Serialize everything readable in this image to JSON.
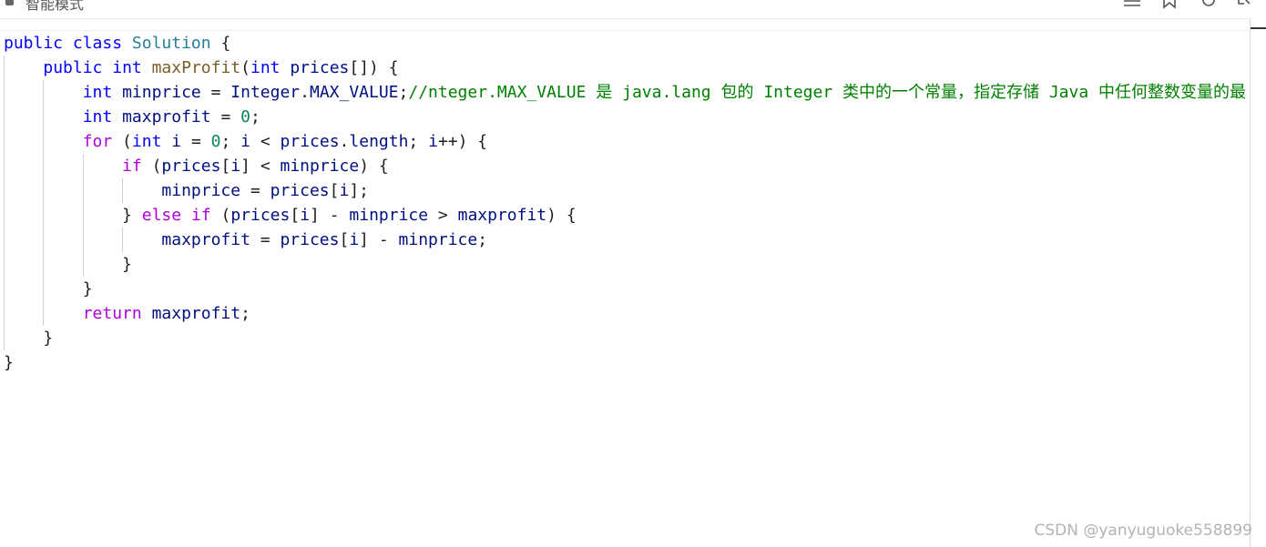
{
  "toolbar": {
    "mode_label": "智能模式",
    "icons": [
      "menu-icon",
      "bookmark-icon",
      "refresh-icon",
      "share-icon"
    ]
  },
  "colors": {
    "keyword": "#0000ff",
    "control": "#af00db",
    "class": "#267f99",
    "function": "#795e26",
    "variable": "#001080",
    "number": "#098658",
    "comment": "#008000",
    "plain": "#1f1f1f"
  },
  "code": {
    "language": "java",
    "lines": [
      {
        "indent": 0,
        "tokens": [
          [
            "kw",
            "public"
          ],
          [
            "p",
            " "
          ],
          [
            "kw",
            "class"
          ],
          [
            "p",
            " "
          ],
          [
            "cls",
            "Solution"
          ],
          [
            "p",
            " {"
          ]
        ]
      },
      {
        "indent": 1,
        "tokens": [
          [
            "kw",
            "public"
          ],
          [
            "p",
            " "
          ],
          [
            "type",
            "int"
          ],
          [
            "p",
            " "
          ],
          [
            "fn",
            "maxProfit"
          ],
          [
            "p",
            "("
          ],
          [
            "type",
            "int"
          ],
          [
            "p",
            " "
          ],
          [
            "var",
            "prices"
          ],
          [
            "p",
            "[]) {"
          ]
        ]
      },
      {
        "indent": 2,
        "tokens": [
          [
            "type",
            "int"
          ],
          [
            "p",
            " "
          ],
          [
            "var",
            "minprice"
          ],
          [
            "p",
            " = "
          ],
          [
            "var",
            "Integer"
          ],
          [
            "p",
            "."
          ],
          [
            "var",
            "MAX_VALUE"
          ],
          [
            "p",
            ";"
          ],
          [
            "com",
            "//nteger.MAX_VALUE 是 java.lang 包的 Integer 类中的一个常量，指定存储 Java 中任何整数变量的最"
          ]
        ]
      },
      {
        "indent": 2,
        "tokens": [
          [
            "type",
            "int"
          ],
          [
            "p",
            " "
          ],
          [
            "var",
            "maxprofit"
          ],
          [
            "p",
            " = "
          ],
          [
            "num",
            "0"
          ],
          [
            "p",
            ";"
          ]
        ]
      },
      {
        "indent": 2,
        "tokens": [
          [
            "ctl",
            "for"
          ],
          [
            "p",
            " ("
          ],
          [
            "type",
            "int"
          ],
          [
            "p",
            " "
          ],
          [
            "var",
            "i"
          ],
          [
            "p",
            " = "
          ],
          [
            "num",
            "0"
          ],
          [
            "p",
            "; "
          ],
          [
            "var",
            "i"
          ],
          [
            "p",
            " < "
          ],
          [
            "var",
            "prices"
          ],
          [
            "p",
            "."
          ],
          [
            "var",
            "length"
          ],
          [
            "p",
            "; "
          ],
          [
            "var",
            "i"
          ],
          [
            "p",
            "++) {"
          ]
        ]
      },
      {
        "indent": 3,
        "tokens": [
          [
            "ctl",
            "if"
          ],
          [
            "p",
            " ("
          ],
          [
            "var",
            "prices"
          ],
          [
            "p",
            "["
          ],
          [
            "var",
            "i"
          ],
          [
            "p",
            "] < "
          ],
          [
            "var",
            "minprice"
          ],
          [
            "p",
            ") {"
          ]
        ]
      },
      {
        "indent": 4,
        "tokens": [
          [
            "var",
            "minprice"
          ],
          [
            "p",
            " = "
          ],
          [
            "var",
            "prices"
          ],
          [
            "p",
            "["
          ],
          [
            "var",
            "i"
          ],
          [
            "p",
            "];"
          ]
        ]
      },
      {
        "indent": 3,
        "tokens": [
          [
            "p",
            "} "
          ],
          [
            "ctl",
            "else"
          ],
          [
            "p",
            " "
          ],
          [
            "ctl",
            "if"
          ],
          [
            "p",
            " ("
          ],
          [
            "var",
            "prices"
          ],
          [
            "p",
            "["
          ],
          [
            "var",
            "i"
          ],
          [
            "p",
            "] - "
          ],
          [
            "var",
            "minprice"
          ],
          [
            "p",
            " > "
          ],
          [
            "var",
            "maxprofit"
          ],
          [
            "p",
            ") {"
          ]
        ]
      },
      {
        "indent": 4,
        "tokens": [
          [
            "var",
            "maxprofit"
          ],
          [
            "p",
            " = "
          ],
          [
            "var",
            "prices"
          ],
          [
            "p",
            "["
          ],
          [
            "var",
            "i"
          ],
          [
            "p",
            "] - "
          ],
          [
            "var",
            "minprice"
          ],
          [
            "p",
            ";"
          ]
        ]
      },
      {
        "indent": 3,
        "tokens": [
          [
            "p",
            "}"
          ]
        ]
      },
      {
        "indent": 2,
        "tokens": [
          [
            "p",
            "}"
          ]
        ]
      },
      {
        "indent": 2,
        "tokens": [
          [
            "ctl",
            "return"
          ],
          [
            "p",
            " "
          ],
          [
            "var",
            "maxprofit"
          ],
          [
            "p",
            ";"
          ]
        ]
      },
      {
        "indent": 1,
        "tokens": [
          [
            "p",
            "}"
          ]
        ]
      },
      {
        "indent": 0,
        "tokens": [
          [
            "p",
            "}"
          ]
        ]
      }
    ]
  },
  "watermark": "CSDN @yanyuguoke558899"
}
